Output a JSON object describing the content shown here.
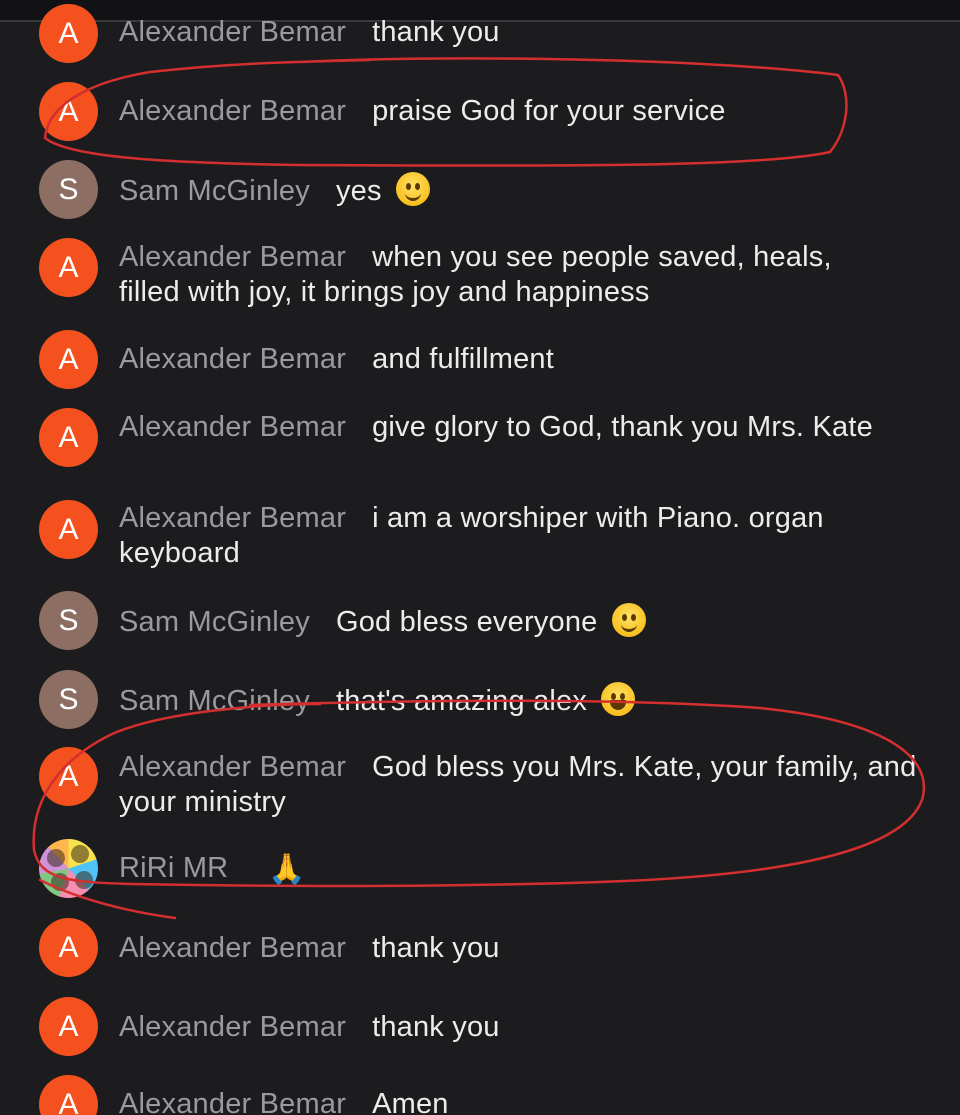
{
  "messages": [
    {
      "initial": "A",
      "name": "Alexander Bemar",
      "text": "thank you"
    },
    {
      "initial": "A",
      "name": "Alexander Bemar",
      "text": "praise God for your service"
    },
    {
      "initial": "S",
      "name": "Sam McGinley",
      "text": "yes"
    },
    {
      "initial": "A",
      "name": "Alexander Bemar",
      "text": "when you see people saved, heals, filled with joy, it brings joy and happiness"
    },
    {
      "initial": "A",
      "name": "Alexander Bemar",
      "text": "and fulfillment"
    },
    {
      "initial": "A",
      "name": "Alexander Bemar",
      "text": "give glory to God, thank you Mrs. Kate"
    },
    {
      "initial": "A",
      "name": "Alexander Bemar",
      "text": "i am a worshiper with Piano. organ keyboard"
    },
    {
      "initial": "S",
      "name": "Sam McGinley",
      "text": "God bless everyone"
    },
    {
      "initial": "S",
      "name": "Sam McGinley",
      "text": "that's amazing alex"
    },
    {
      "initial": "A",
      "name": "Alexander Bemar",
      "text": "God bless you Mrs. Kate, your family, and your ministry"
    },
    {
      "initial": "",
      "name": "RiRi MR",
      "text": "🙏"
    },
    {
      "initial": "A",
      "name": "Alexander Bemar",
      "text": "thank you"
    },
    {
      "initial": "A",
      "name": "Alexander Bemar",
      "text": "thank you"
    },
    {
      "initial": "A",
      "name": "Alexander Bemar",
      "text": "Amen"
    }
  ],
  "colors": {
    "background": "#1c1c1e",
    "avatar_orange": "#f4511e",
    "avatar_brown": "#8d6e63",
    "name_gray": "#9a9a9e",
    "text": "#ececec",
    "annotation_red": "#d32f2f"
  },
  "icons": {
    "m2_emoji": "slightly-smiling-face-icon",
    "m7_emoji": "smiling-face-icon",
    "m8_emoji": "grinning-face-icon",
    "m10_emoji": "folded-hands-icon"
  }
}
